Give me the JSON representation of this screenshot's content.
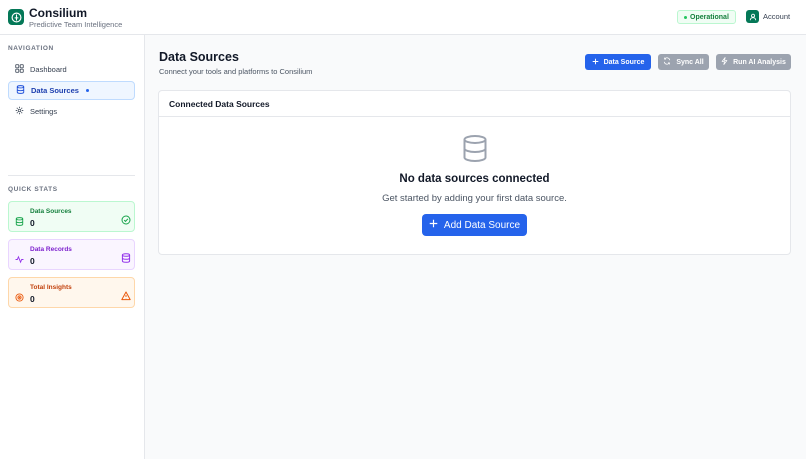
{
  "app": {
    "name": "Consilium",
    "subtitle": "Predictive Team Intelligence"
  },
  "header": {
    "status_label": "Operational",
    "account_label": "Account"
  },
  "sidebar": {
    "nav_heading": "NAVIGATION",
    "items": [
      {
        "label": "Dashboard",
        "icon": "grid-icon",
        "active": false
      },
      {
        "label": "Data Sources",
        "icon": "database-icon",
        "active": true
      },
      {
        "label": "Settings",
        "icon": "gear-icon",
        "active": false
      }
    ],
    "stats_heading": "QUICK STATS",
    "stats": [
      {
        "label": "Data Sources",
        "value": "0",
        "icon": "database-icon",
        "right_icon": "check-circle-icon",
        "color": "#15803d"
      },
      {
        "label": "Data Records",
        "value": "0",
        "icon": "activity-icon",
        "right_icon": "database-icon",
        "color": "#7e22ce"
      },
      {
        "label": "Total Insights",
        "value": "0",
        "icon": "target-icon",
        "right_icon": "warning-icon",
        "color": "#c2410c"
      }
    ]
  },
  "main": {
    "title": "Data Sources",
    "subtitle": "Connect your tools and platforms to Consilium",
    "buttons": {
      "add": "Data Source",
      "sync": "Sync All",
      "ai": "Run AI Analysis"
    },
    "card": {
      "title": "Connected Data Sources",
      "empty_title": "No data sources connected",
      "empty_subtitle": "Get started by adding your first data source.",
      "add_button": "Add Data Source"
    }
  },
  "colors": {
    "brand": "#047857",
    "primary": "#2563eb",
    "disabled": "#9ca3af"
  }
}
